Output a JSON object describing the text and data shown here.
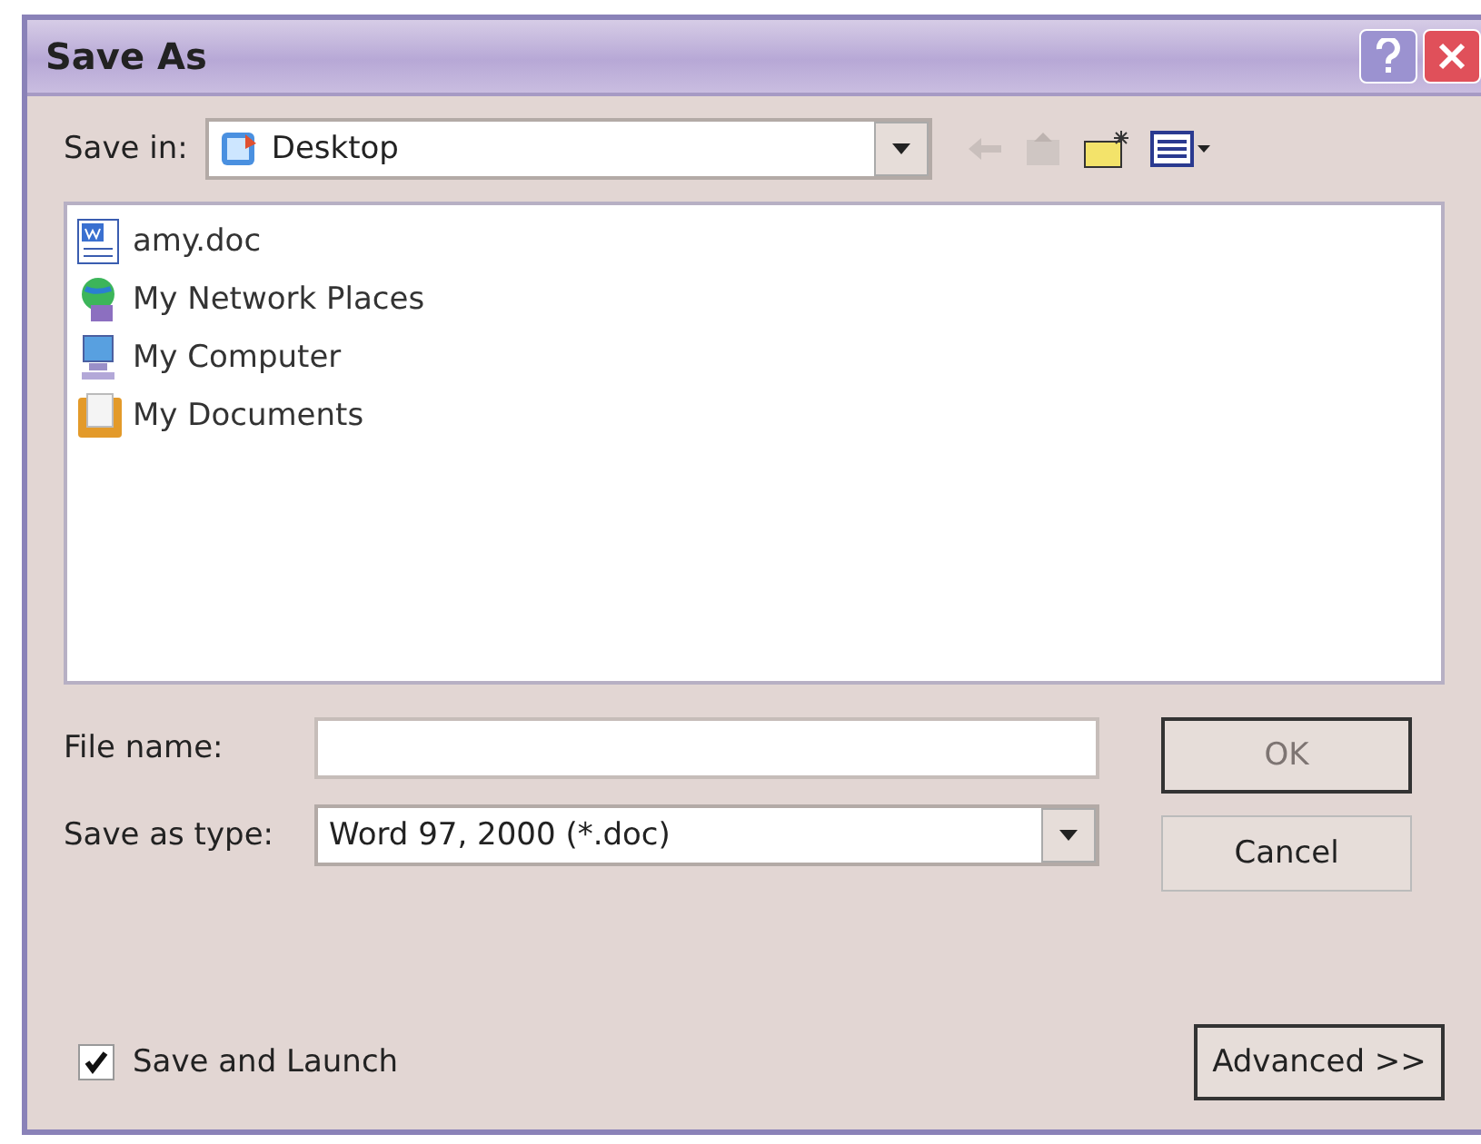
{
  "window": {
    "title": "Save As"
  },
  "save_in": {
    "label": "Save in:",
    "value": "Desktop"
  },
  "files": [
    {
      "name": "amy.doc",
      "kind": "doc"
    },
    {
      "name": "My Network Places",
      "kind": "network"
    },
    {
      "name": "My Computer",
      "kind": "computer"
    },
    {
      "name": "My Documents",
      "kind": "documents"
    }
  ],
  "file_name": {
    "label": "File name:"
  },
  "save_as_type": {
    "label": "Save as type:",
    "value": "Word 97, 2000 (*.doc)"
  },
  "buttons": [
    {
      "label": "OK",
      "disabled": true
    },
    {
      "label": "Cancel",
      "disabled": false
    }
  ],
  "save_and_launch": {
    "label": "Save and Launch",
    "checked": true
  },
  "advanced": {
    "label": "Advanced >>"
  }
}
